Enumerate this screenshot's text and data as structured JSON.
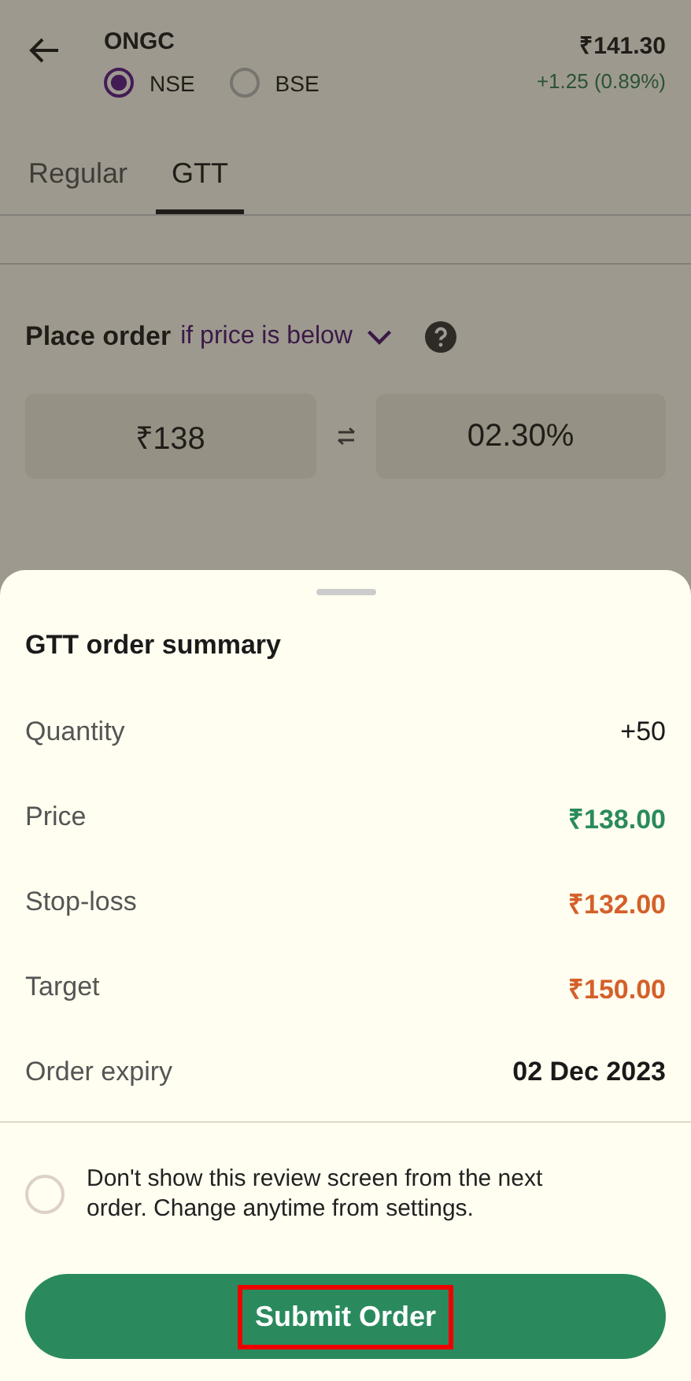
{
  "header": {
    "symbol": "ONGC",
    "exchanges": [
      {
        "label": "NSE",
        "selected": true
      },
      {
        "label": "BSE",
        "selected": false
      }
    ],
    "price": "₹141.30",
    "change": "+1.25 (0.89%)"
  },
  "tabs": [
    {
      "label": "Regular",
      "selected": false
    },
    {
      "label": "GTT",
      "selected": true
    }
  ],
  "trigger": {
    "label": "Place order",
    "condition": "if price is below"
  },
  "inputs": {
    "price": "₹138",
    "percent": "02.30%"
  },
  "summary": {
    "title": "GTT order summary",
    "rows": [
      {
        "label": "Quantity",
        "value": "+50",
        "color": "#1a1a1a",
        "emphasized": false
      },
      {
        "label": "Price",
        "value": "₹138.00",
        "color": "#2a8a5c",
        "emphasized": true
      },
      {
        "label": "Stop-loss",
        "value": "₹132.00",
        "color": "#d4602a",
        "emphasized": true
      },
      {
        "label": "Target",
        "value": "₹150.00",
        "color": "#d4602a",
        "emphasized": true
      },
      {
        "label": "Order expiry",
        "value": "02 Dec 2023",
        "color": "#1a1a1a",
        "emphasized": true
      }
    ],
    "skip_review": {
      "label": "Don't show this review screen from the next order. Change anytime from settings.",
      "checked": false
    },
    "submit": {
      "label": "Submit Order",
      "highlighted": true
    }
  }
}
